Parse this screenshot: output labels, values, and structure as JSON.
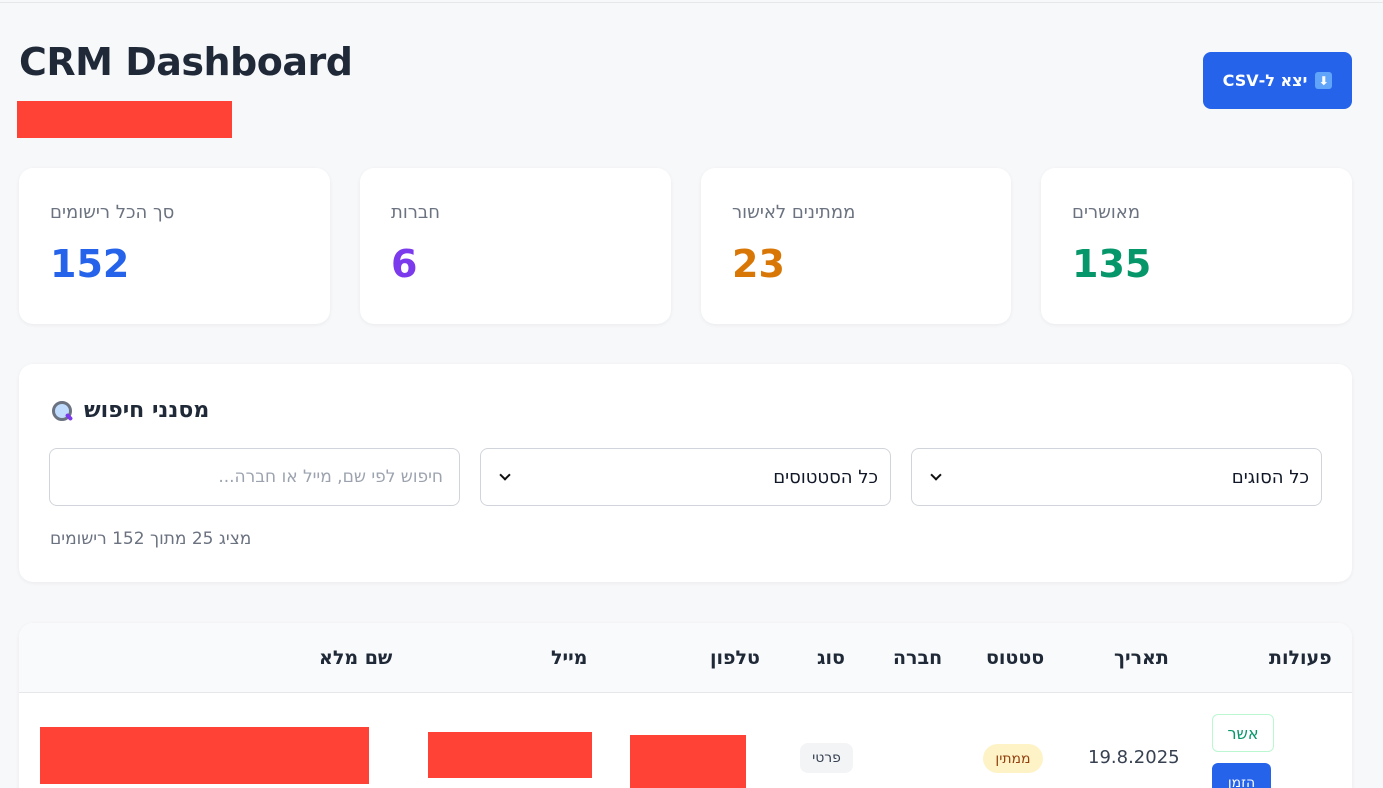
{
  "header": {
    "title": "CRM Dashboard",
    "export_label": "יצא ל-CSV",
    "export_icon": "download-icon"
  },
  "stats": [
    {
      "label": "סך הכל רישומים",
      "value": "152",
      "color": "#2563eb"
    },
    {
      "label": "חברות",
      "value": "6",
      "color": "#7c3aed"
    },
    {
      "label": "ממתינים לאישור",
      "value": "23",
      "color": "#d97706"
    },
    {
      "label": "מאושרים",
      "value": "135",
      "color": "#059669"
    }
  ],
  "filters": {
    "title": "מסנני חיפוש",
    "search_placeholder": "חיפוש לפי שם, מייל או חברה...",
    "status_selected": "כל הסטטוסים",
    "type_selected": "כל הסוגים",
    "results_text": "מציג 25 מתוך 152 רישומים"
  },
  "table": {
    "columns": [
      "שם מלא",
      "מייל",
      "טלפון",
      "סוג",
      "חברה",
      "סטטוס",
      "תאריך",
      "פעולות"
    ],
    "rows": [
      {
        "full_name": "",
        "email": "",
        "phone": "",
        "type": "פרטי",
        "company": "",
        "status": "ממתין",
        "date": "19.8.2025",
        "approve_label": "אשר",
        "invite_label": "הזמן"
      }
    ]
  },
  "colors": {
    "primary": "#2563eb",
    "pending_badge_bg": "#fef3c7",
    "pending_badge_text": "#92400e",
    "type_badge_bg": "#f3f4f6"
  }
}
